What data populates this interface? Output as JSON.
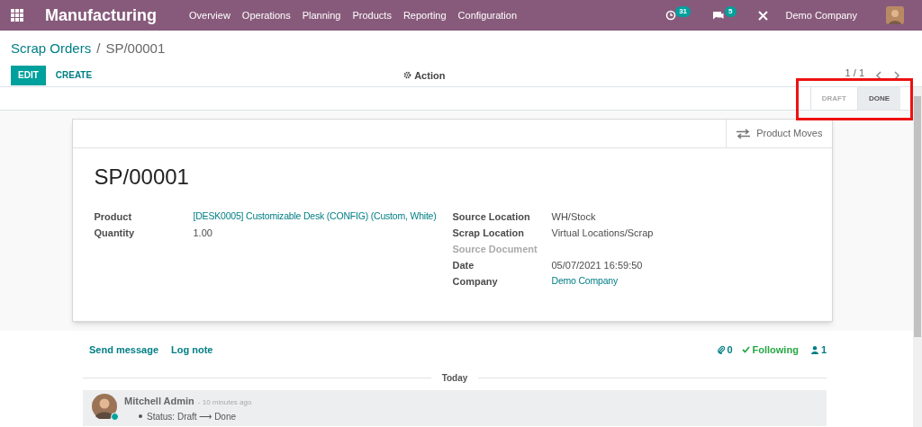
{
  "navbar": {
    "app_name": "Manufacturing",
    "menus": [
      "Overview",
      "Operations",
      "Planning",
      "Products",
      "Reporting",
      "Configuration"
    ],
    "activity_count": "31",
    "message_count": "5",
    "company": "Demo Company"
  },
  "breadcrumb": {
    "parent": "Scrap Orders",
    "separator": "/",
    "current": "SP/00001"
  },
  "buttons": {
    "edit": "EDIT",
    "create": "CREATE",
    "action": "Action"
  },
  "pager": {
    "value": "1 / 1"
  },
  "statusbar": {
    "highlighted": true,
    "stages": [
      {
        "label": "DRAFT",
        "selected": false
      },
      {
        "label": "DONE",
        "selected": true
      }
    ]
  },
  "sheet": {
    "smart_button": "Product Moves",
    "title": "SP/00001",
    "left_fields": [
      {
        "label": "Product",
        "value": "[DESK0005] Customizable Desk (CONFIG) (Custom, White)",
        "kind": "link"
      },
      {
        "label": "Quantity",
        "value": "1.00",
        "kind": "text"
      }
    ],
    "right_fields": [
      {
        "label": "Source Location",
        "value": "WH/Stock",
        "kind": "text"
      },
      {
        "label": "Scrap Location",
        "value": "Virtual Locations/Scrap",
        "kind": "text"
      },
      {
        "label": "Source Document",
        "kind": "empty"
      },
      {
        "label": "Date",
        "value": "05/07/2021 16:59:50",
        "kind": "text"
      },
      {
        "label": "Company",
        "value": "Demo Company",
        "kind": "link"
      }
    ]
  },
  "chatter": {
    "send_message": "Send message",
    "log_note": "Log note",
    "attachments": "0",
    "following": "Following",
    "followers": "1",
    "separator": "Today",
    "messages": [
      {
        "author": "Mitchell Admin",
        "time": "- 10 minutes ago",
        "online": true,
        "tracking": "Status: Draft ⟶ Done"
      }
    ]
  }
}
